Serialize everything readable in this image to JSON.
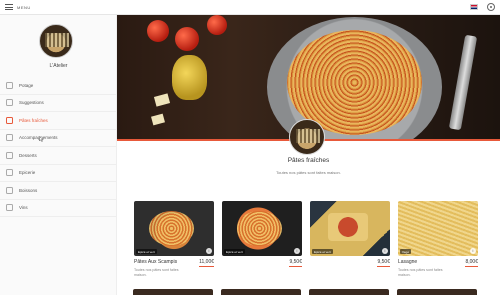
{
  "topbar": {
    "menu_label": "MENU",
    "icons": [
      "hamburger-icon",
      "uk-flag-icon",
      "gear-icon"
    ]
  },
  "sidebar": {
    "restaurant_name": "L'Atelier",
    "items": [
      {
        "label": "Potage",
        "icon": "pot-icon"
      },
      {
        "label": "Suggestions",
        "icon": "star-icon"
      },
      {
        "label": "Pâtes fraîches",
        "icon": "pasta-icon",
        "active": true
      },
      {
        "label": "Accompagnements",
        "icon": "plate-icon"
      },
      {
        "label": "Desserts",
        "icon": "cake-icon"
      },
      {
        "label": "Epicerie",
        "icon": "basket-icon"
      },
      {
        "label": "Boissons",
        "icon": "bottle-icon"
      },
      {
        "label": "Vins",
        "icon": "wine-icon"
      }
    ]
  },
  "category": {
    "title": "Pâtes fraîches",
    "subtitle": "Toutes nos pâtes sont faites maison."
  },
  "products": [
    {
      "name": "Pâtes Aux Scampis",
      "price": "11,00€",
      "badge": "Epicé et vert",
      "desc": "Toutes nos pâtes sont faites maison."
    },
    {
      "name": "",
      "price": "9,50€",
      "badge": "Epicé et vert",
      "desc": ""
    },
    {
      "name": "",
      "price": "9,50€",
      "badge": "Epicé et vert",
      "desc": ""
    },
    {
      "name": "Lasagne",
      "price": "8,00€",
      "badge": "Végé",
      "desc": "Toutes nos pâtes sont faites maison."
    }
  ],
  "colors": {
    "accent": "#e8593a",
    "sidebar_bg": "#fafafa"
  }
}
